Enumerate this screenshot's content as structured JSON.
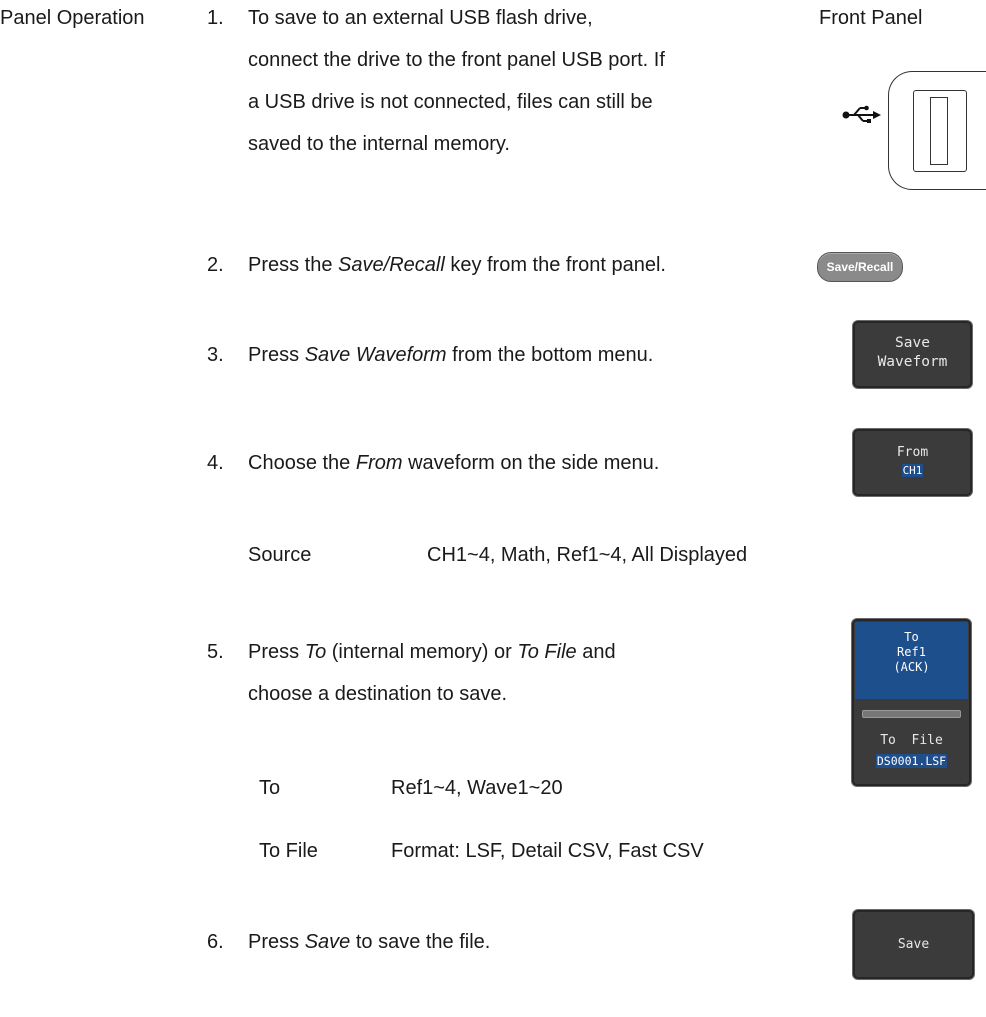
{
  "side_heading": "Panel Operation",
  "front_panel_label": "Front Panel",
  "steps": [
    {
      "num": "1.",
      "lines": [
        "To save to an external USB flash drive,",
        "connect the drive to the front panel USB port. If",
        "a USB drive is not connected, files can still be",
        "saved to the internal memory."
      ]
    },
    {
      "num": "2.",
      "pre": "Press the ",
      "em": "Save/Recall",
      "post": " key from the front panel."
    },
    {
      "num": "3.",
      "pre": "Press ",
      "em": "Save Waveform",
      "post": " from the bottom menu."
    },
    {
      "num": "4.",
      "pre": "Choose the ",
      "em": "From",
      "post": " waveform on the side menu."
    },
    {
      "num": "5.",
      "pre": "Press ",
      "em": "To",
      "mid": " (internal memory) or ",
      "em2": "To File",
      "post": " and",
      "line2": "choose a destination to save."
    },
    {
      "num": "6.",
      "pre": "Press ",
      "em": "Save",
      "post": " to save the file."
    }
  ],
  "params": {
    "source": {
      "label": "Source",
      "value": "CH1~4, Math, Ref1~4, All Displayed"
    },
    "to": {
      "label": "To",
      "value": "Ref1~4, Wave1~20"
    },
    "to_file": {
      "label": "To File",
      "value": "Format: LSF, Detail CSV, Fast CSV"
    }
  },
  "keys": {
    "save_recall": "Save/Recall",
    "save_waveform": [
      "Save",
      "Waveform"
    ],
    "from": {
      "label": "From",
      "value": "CH1"
    },
    "to": {
      "label": "To",
      "ref": "Ref1",
      "ack": "(ACK)",
      "file_label": "To  File",
      "file_value": "DS0001.LSF"
    },
    "save": "Save"
  },
  "icons": {
    "usb": "usb-icon",
    "usb_port": "usb-port-icon"
  },
  "colors": {
    "softkey_bg": "#3b3b3b",
    "highlight": "#1d4f8d",
    "key_grey": "#8a8a8a"
  }
}
